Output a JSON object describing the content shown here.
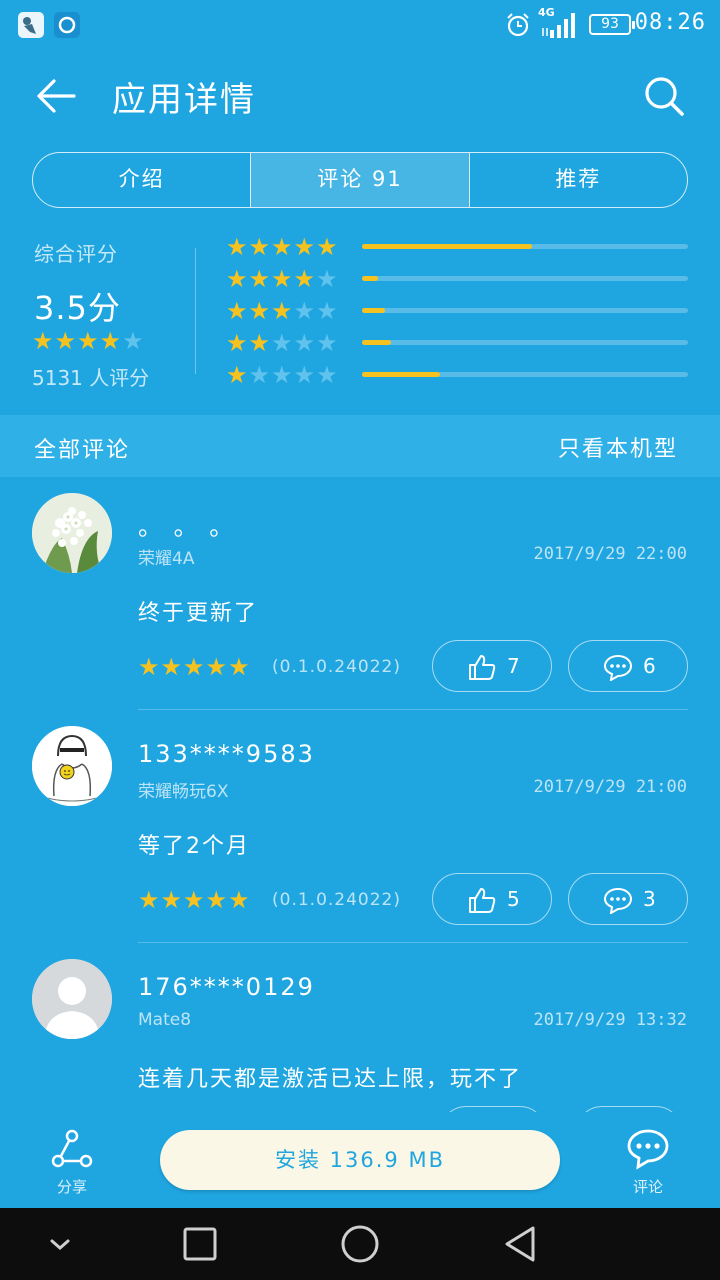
{
  "status_bar": {
    "network": "4G",
    "battery": "93",
    "time": "08:26"
  },
  "header": {
    "title": "应用详情",
    "back_icon": "arrow-left-icon",
    "search_icon": "search-icon"
  },
  "tabs": [
    {
      "label": "介绍",
      "active": false
    },
    {
      "label": "评论 91",
      "active": true
    },
    {
      "label": "推荐",
      "active": false
    }
  ],
  "rating": {
    "label": "综合评分",
    "score": "3.5分",
    "stars": 4,
    "count": "5131 人评分",
    "distribution": [
      {
        "stars": 5,
        "fraction": 0.52
      },
      {
        "stars": 4,
        "fraction": 0.05
      },
      {
        "stars": 3,
        "fraction": 0.07
      },
      {
        "stars": 2,
        "fraction": 0.09
      },
      {
        "stars": 1,
        "fraction": 0.24
      }
    ]
  },
  "section": {
    "title": "全部评论",
    "filter": "只看本机型"
  },
  "reviews": [
    {
      "name": "。 。 。",
      "device": "荣耀4A",
      "time": "2017/9/29 22:00",
      "text": "终于更新了",
      "stars": 5,
      "version": "(0.1.0.24022)",
      "likes": "7",
      "comments": "6",
      "avatar": "flower-photo"
    },
    {
      "name": "133****9583",
      "device": "荣耀畅玩6X",
      "time": "2017/9/29 21:00",
      "text": "等了2个月",
      "stars": 5,
      "version": "(0.1.0.24022)",
      "likes": "5",
      "comments": "3",
      "avatar": "sketch-figure"
    },
    {
      "name": "176****0129",
      "device": "Mate8",
      "time": "2017/9/29 13:32",
      "text": "连着几天都是激活已达上限，玩不了",
      "avatar": "default-user"
    }
  ],
  "bottom_bar": {
    "share_label": "分享",
    "install_label": "安装 136.9 MB",
    "comment_label": "评论"
  },
  "colors": {
    "background": "#1fa6e0",
    "star": "#f6c21f",
    "install_button": "#fbf7e6"
  }
}
